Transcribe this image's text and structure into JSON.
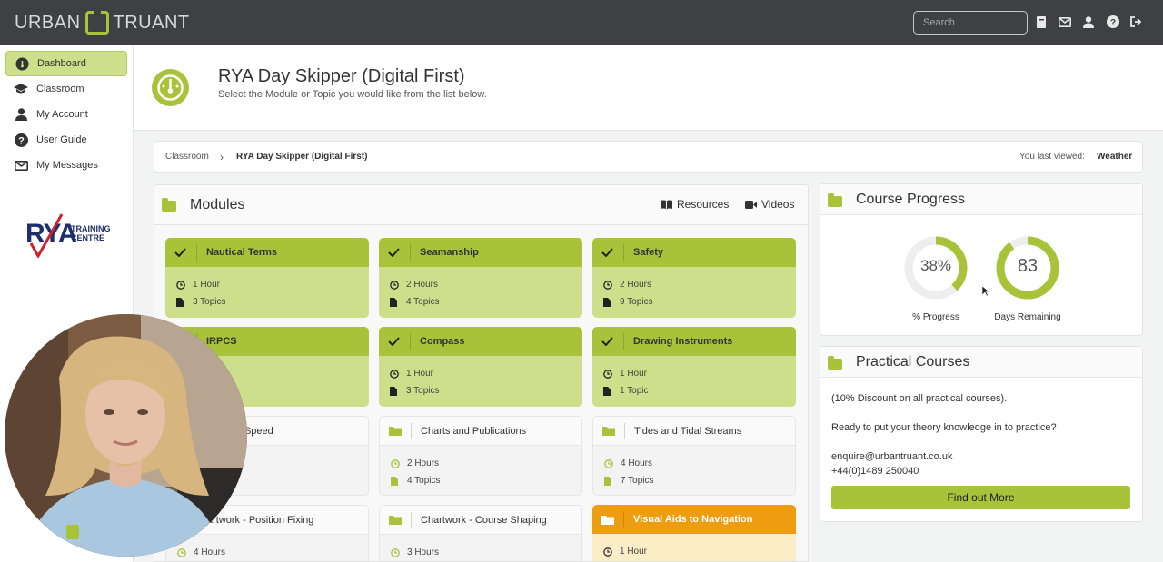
{
  "brand": {
    "logo_left": "URBAN",
    "logo_right": "TRUANT",
    "accent": "#a8c23a"
  },
  "topbar": {
    "search_placeholder": "Search",
    "icons": [
      "book-icon",
      "envelope-icon",
      "user-icon",
      "help-icon",
      "logout-icon"
    ]
  },
  "sidebar": {
    "items": [
      {
        "label": "Dashboard",
        "icon": "dashboard-icon",
        "active": true
      },
      {
        "label": "Classroom",
        "icon": "graduation-cap-icon"
      },
      {
        "label": "My Account",
        "icon": "user-icon"
      },
      {
        "label": "User Guide",
        "icon": "question-icon"
      },
      {
        "label": "My Messages",
        "icon": "envelope-icon"
      }
    ],
    "rya_logo": {
      "main": "RYA",
      "sub1": "TRAINING",
      "sub2": "CENTRE"
    }
  },
  "header": {
    "title": "RYA Day Skipper (Digital First)",
    "subtitle": "Select the Module or Topic you would like from the list below."
  },
  "breadcrumb": {
    "root": "Classroom",
    "current": "RYA Day Skipper (Digital First)",
    "last_viewed_label": "You last viewed:",
    "last_viewed_value": "Weather"
  },
  "modules": {
    "title": "Modules",
    "resources_label": "Resources",
    "videos_label": "Videos",
    "cards": [
      {
        "title": "Nautical Terms",
        "hours": "1 Hour",
        "topics": "3 Topics",
        "status": "done"
      },
      {
        "title": "Seamanship",
        "hours": "2 Hours",
        "topics": "4 Topics",
        "status": "done"
      },
      {
        "title": "Safety",
        "hours": "2 Hours",
        "topics": "9 Topics",
        "status": "done"
      },
      {
        "title": "IRPCS",
        "hours": "",
        "topics": "",
        "status": "done"
      },
      {
        "title": "Compass",
        "hours": "1 Hour",
        "topics": "3 Topics",
        "status": "done"
      },
      {
        "title": "Drawing Instruments",
        "hours": "1 Hour",
        "topics": "1 Topic",
        "status": "done"
      },
      {
        "title": "ourse & Speed",
        "hours": "",
        "topics": "",
        "status": "todo"
      },
      {
        "title": "Charts and Publications",
        "hours": "2 Hours",
        "topics": "4 Topics",
        "status": "todo"
      },
      {
        "title": "Tides and Tidal Streams",
        "hours": "4 Hours",
        "topics": "7 Topics",
        "status": "todo"
      },
      {
        "title": "artwork - Position Fixing",
        "hours": "4 Hours",
        "topics": "",
        "status": "todo"
      },
      {
        "title": "Chartwork - Course Shaping",
        "hours": "3 Hours",
        "topics": "",
        "status": "todo"
      },
      {
        "title": "Visual Aids to Navigation",
        "hours": "1 Hour",
        "topics": "",
        "status": "current"
      }
    ]
  },
  "progress": {
    "title": "Course Progress",
    "percent_value": "38%",
    "percent": 38,
    "percent_label": "% Progress",
    "days_value": "83",
    "days_fill": 0.9,
    "days_label": "Days Remaining"
  },
  "practical": {
    "title": "Practical Courses",
    "discount": "(10% Discount on all practical courses).",
    "prompt": "Ready to put your theory knowledge in to practice?",
    "email": "enquire@urbantruant.co.uk",
    "phone": "+44(0)1489 250040",
    "button": "Find out More"
  },
  "colors": {
    "done_head": "#a8c23a",
    "done_body": "#cddf8b",
    "current_head": "#ef9d10",
    "current_body": "#fbeec6"
  }
}
